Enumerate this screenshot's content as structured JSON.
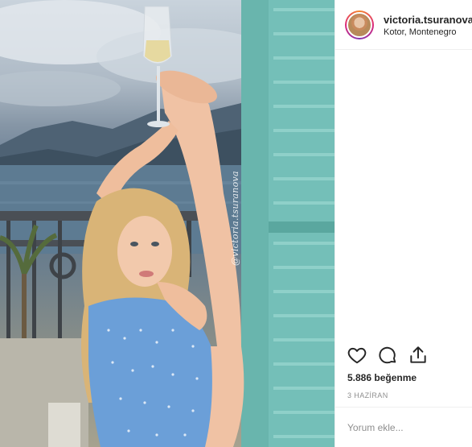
{
  "post": {
    "username": "victoria.tsuranova",
    "location": "Kotor, Montenegro",
    "likes": "5.886 beğenme",
    "date": "3 HAZİRAN",
    "comment_placeholder": "Yorum ekle..."
  },
  "photo": {
    "watermark": "@victoria.tsuranova"
  },
  "icons": {
    "like": "heart-icon",
    "comment": "comment-icon",
    "share": "share-icon"
  },
  "colors": {
    "text": "#262626",
    "muted": "#8e8e8e",
    "divider": "#efefef",
    "shutter": "#7cc4bd"
  }
}
